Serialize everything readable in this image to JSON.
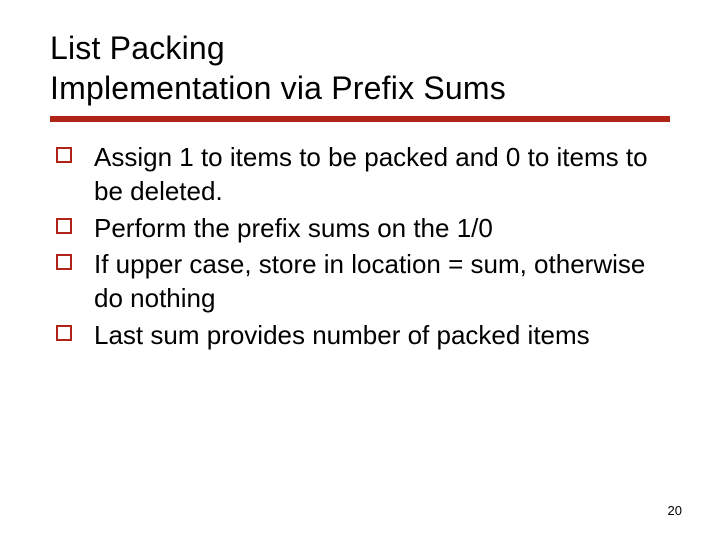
{
  "title_line1": "List Packing",
  "title_line2": "Implementation via Prefix Sums",
  "bullets": [
    "Assign 1 to items to be packed and 0 to items to be deleted.",
    "Perform the prefix sums on the 1/0",
    "If upper case, store in location = sum, otherwise do nothing",
    "Last sum provides number of packed items"
  ],
  "page_number": "20"
}
